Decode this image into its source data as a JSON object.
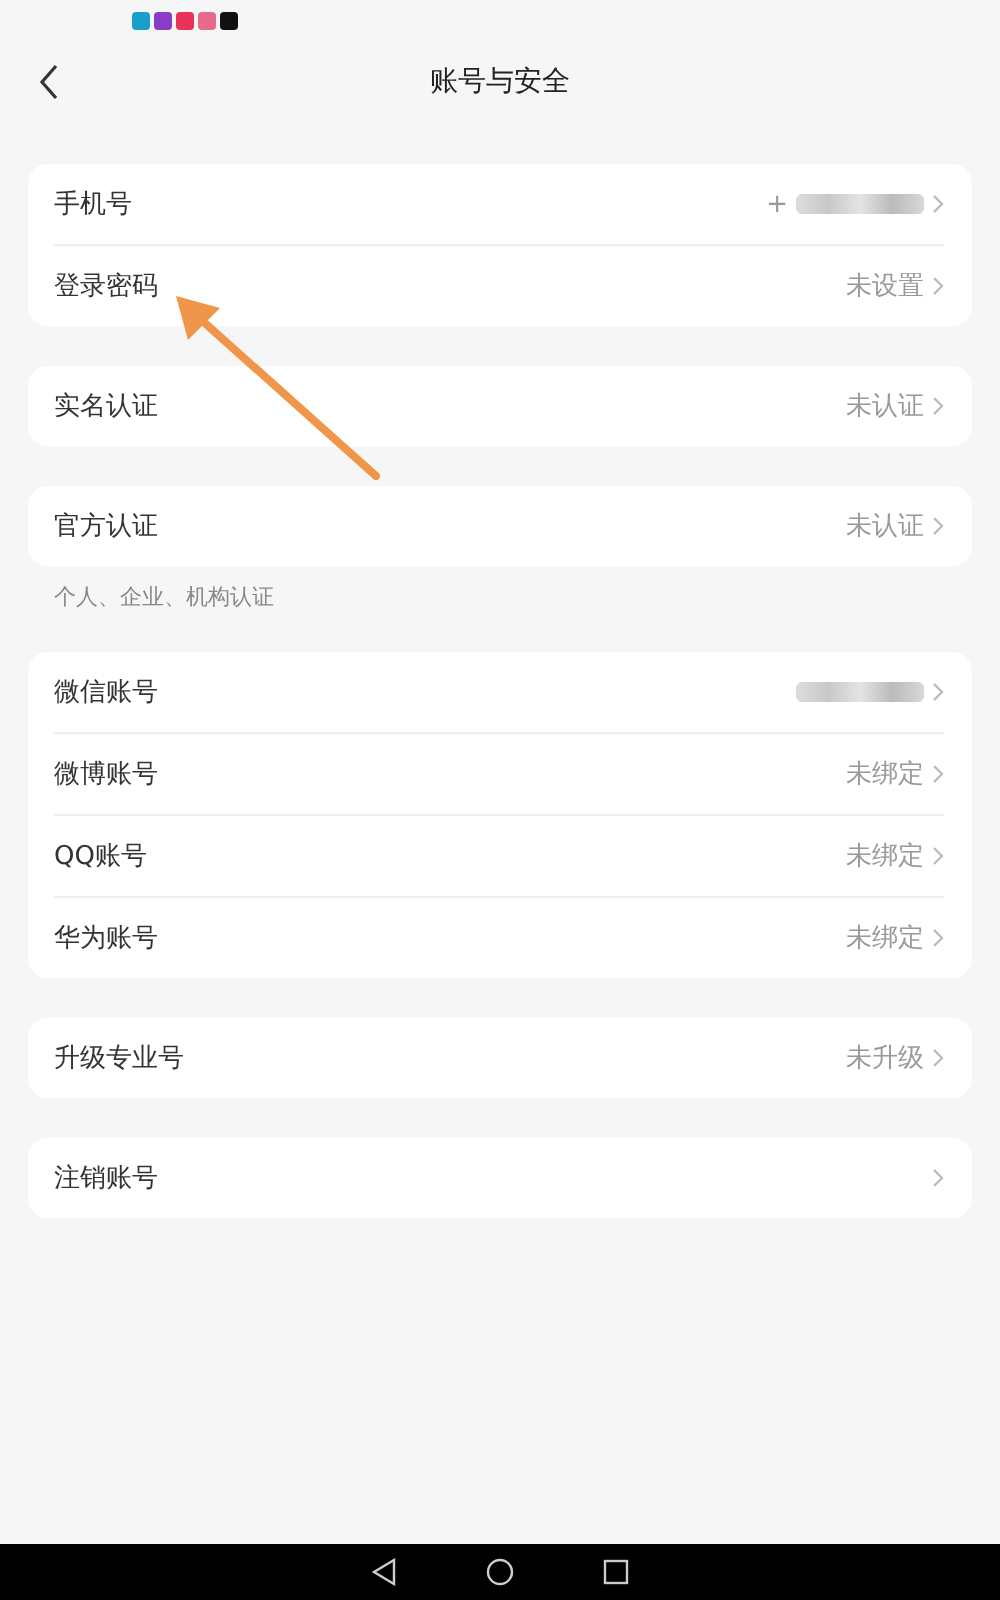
{
  "header": {
    "title": "账号与安全"
  },
  "groups": [
    {
      "rows": [
        {
          "label": "手机号",
          "value": "+",
          "redacted": true
        },
        {
          "label": "登录密码",
          "value": "未设置"
        }
      ]
    },
    {
      "rows": [
        {
          "label": "实名认证",
          "value": "未认证"
        }
      ]
    },
    {
      "rows": [
        {
          "label": "官方认证",
          "value": "未认证"
        }
      ],
      "note": "个人、企业、机构认证"
    },
    {
      "rows": [
        {
          "label": "微信账号",
          "redacted": true
        },
        {
          "label": "微博账号",
          "value": "未绑定"
        },
        {
          "label": "QQ账号",
          "value": "未绑定"
        },
        {
          "label": "华为账号",
          "value": "未绑定"
        }
      ]
    },
    {
      "rows": [
        {
          "label": "升级专业号",
          "value": "未升级"
        }
      ]
    },
    {
      "rows": [
        {
          "label": "注销账号"
        }
      ]
    }
  ]
}
